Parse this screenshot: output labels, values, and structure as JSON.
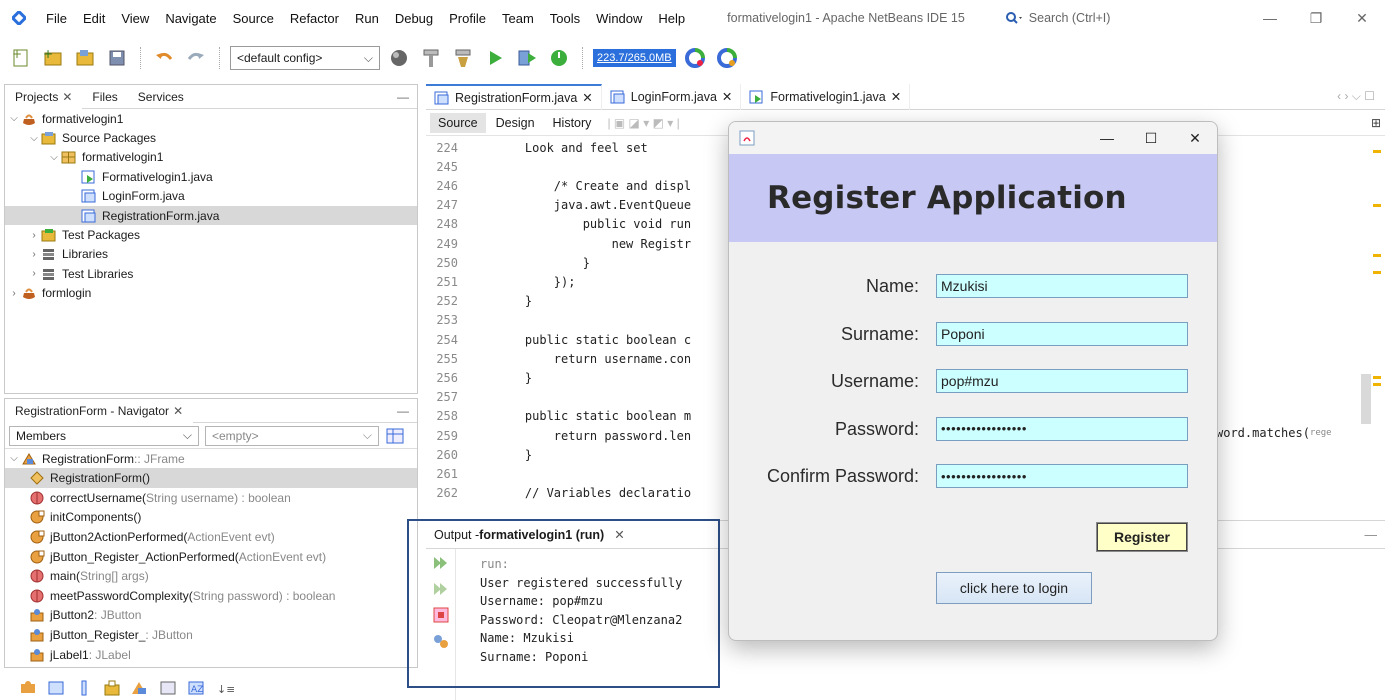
{
  "menubar": {
    "items": [
      "File",
      "Edit",
      "View",
      "Navigate",
      "Source",
      "Refactor",
      "Run",
      "Debug",
      "Profile",
      "Team",
      "Tools",
      "Window",
      "Help"
    ],
    "window_title": "formativelogin1 - Apache NetBeans IDE 15",
    "search_placeholder": "Search (Ctrl+I)"
  },
  "toolbar": {
    "config": "<default config>",
    "memory": "223.7/265.0MB"
  },
  "projects_pane": {
    "tabs": [
      "Projects",
      "Files",
      "Services"
    ],
    "tree": [
      {
        "label": "formativelogin1",
        "indent": 0,
        "chev": "v",
        "icon": "project-icon"
      },
      {
        "label": "Source Packages",
        "indent": 1,
        "chev": "v",
        "icon": "source-packages-icon"
      },
      {
        "label": "formativelogin1",
        "indent": 2,
        "chev": "v",
        "icon": "package-icon"
      },
      {
        "label": "Formativelogin1.java",
        "indent": 3,
        "chev": "",
        "icon": "java-file-icon"
      },
      {
        "label": "LoginForm.java",
        "indent": 3,
        "chev": "",
        "icon": "form-file-icon"
      },
      {
        "label": "RegistrationForm.java",
        "indent": 3,
        "chev": "",
        "icon": "form-file-icon",
        "selected": true
      },
      {
        "label": "Test Packages",
        "indent": 1,
        "chev": ">",
        "icon": "test-packages-icon"
      },
      {
        "label": "Libraries",
        "indent": 1,
        "chev": ">",
        "icon": "libraries-icon"
      },
      {
        "label": "Test Libraries",
        "indent": 1,
        "chev": ">",
        "icon": "libraries-icon"
      },
      {
        "label": "formlogin",
        "indent": 0,
        "chev": ">",
        "icon": "project-icon"
      }
    ]
  },
  "navigator": {
    "title": "RegistrationForm - Navigator",
    "filter_value": "Members",
    "filter2_value": "<empty>",
    "root_label": "RegistrationForm",
    "root_type": " :: JFrame",
    "members": [
      {
        "name": "RegistrationForm()",
        "sig": "",
        "icon": "constructor-icon",
        "selected": true
      },
      {
        "name": "correctUsername(",
        "sig": "String username) : boolean",
        "icon": "static-method-icon"
      },
      {
        "name": "initComponents()",
        "sig": "",
        "icon": "private-method-icon"
      },
      {
        "name": "jButton2ActionPerformed(",
        "sig": "ActionEvent evt)",
        "icon": "private-method-icon"
      },
      {
        "name": "jButton_Register_ActionPerformed(",
        "sig": "ActionEvent evt)",
        "icon": "private-method-icon"
      },
      {
        "name": "main(",
        "sig": "String[] args)",
        "icon": "static-method-icon"
      },
      {
        "name": "meetPasswordComplexity(",
        "sig": "String password) : boolean",
        "icon": "static-method-icon"
      },
      {
        "name": "jButton2",
        "sig": " : JButton",
        "icon": "field-icon"
      },
      {
        "name": "jButton_Register_",
        "sig": " : JButton",
        "icon": "field-icon"
      },
      {
        "name": "jLabel1",
        "sig": " : JLabel",
        "icon": "field-icon"
      }
    ]
  },
  "editor": {
    "tabs": [
      "RegistrationForm.java",
      "LoginForm.java",
      "Formativelogin1.java"
    ],
    "subtabs": [
      "Source",
      "Design",
      "History"
    ],
    "lines": [
      {
        "n": "224",
        "t": "    Look and feel set"
      },
      {
        "n": "245",
        "t": ""
      },
      {
        "n": "246",
        "t": "        /* Create and displ"
      },
      {
        "n": "247",
        "t": "        java.awt.EventQueue"
      },
      {
        "n": "248",
        "t": "            public void run"
      },
      {
        "n": "249",
        "t": "                new Registr"
      },
      {
        "n": "250",
        "t": "            }"
      },
      {
        "n": "251",
        "t": "        });"
      },
      {
        "n": "252",
        "t": "    }"
      },
      {
        "n": "253",
        "t": ""
      },
      {
        "n": "254",
        "t": "    public static boolean c"
      },
      {
        "n": "255",
        "t": "        return username.con"
      },
      {
        "n": "256",
        "t": "    }"
      },
      {
        "n": "257",
        "t": ""
      },
      {
        "n": "258",
        "t": "    public static boolean m"
      },
      {
        "n": "259",
        "t": "        return password.len"
      },
      {
        "n": "260",
        "t": "    }"
      },
      {
        "n": "261",
        "t": ""
      },
      {
        "n": "262",
        "t": "    // Variables declaratio"
      }
    ],
    "right_code": "word.matches(",
    "right_code_tail": "rege"
  },
  "output": {
    "tab_prefix": "Output - ",
    "tab_title": "formativelogin1 (run)",
    "lines": [
      "run:",
      "User registered successfully",
      "Username: pop#mzu",
      "Password: Cleopatr@Mlenzana2",
      "Name: Mzukisi",
      "Surname: Poponi"
    ]
  },
  "dialog": {
    "header": "Register Application",
    "fields": [
      {
        "label": "Name:",
        "value": "Mzukisi",
        "masked": false
      },
      {
        "label": "Surname:",
        "value": "Poponi",
        "masked": false
      },
      {
        "label": "Username:",
        "value": "pop#mzu",
        "masked": false
      },
      {
        "label": "Password:",
        "value": "•••••••••••••••••",
        "masked": true
      },
      {
        "label": "Confirm Password:",
        "value": "•••••••••••••••••",
        "masked": true
      }
    ],
    "register_label": "Register",
    "login_label": "click here to login"
  },
  "colors": {
    "dialog_header_bg": "#c8c8f4",
    "input_bg": "#ccffff",
    "register_bg": "#ffffc8",
    "memory_bg": "#2a6fdb",
    "highlight_frame": "#2d4e86"
  }
}
